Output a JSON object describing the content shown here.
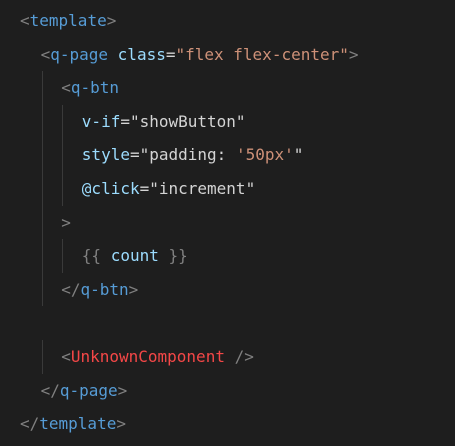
{
  "editor": {
    "language": "vue",
    "colors": {
      "background": "#1e1e1e",
      "punctuation": "#808080",
      "tag": "#569cd6",
      "attribute": "#9cdcfe",
      "string": "#ce9178",
      "text": "#d4d4d4",
      "unknown_component": "#f44747"
    },
    "lines": [
      {
        "indent": 0,
        "tokens": [
          {
            "t": "<",
            "c": "punct"
          },
          {
            "t": "template",
            "c": "tag"
          },
          {
            "t": ">",
            "c": "punct"
          }
        ]
      },
      {
        "indent": 1,
        "tokens": [
          {
            "t": "<",
            "c": "punct"
          },
          {
            "t": "q-page",
            "c": "tag"
          },
          {
            "t": " ",
            "c": "text"
          },
          {
            "t": "class",
            "c": "attr"
          },
          {
            "t": "=",
            "c": "text"
          },
          {
            "t": "\"flex flex-center\"",
            "c": "str"
          },
          {
            "t": ">",
            "c": "punct"
          }
        ]
      },
      {
        "indent": 2,
        "tokens": [
          {
            "t": "<",
            "c": "punct"
          },
          {
            "t": "q-btn",
            "c": "tag"
          }
        ]
      },
      {
        "indent": 3,
        "tokens": [
          {
            "t": "v-if",
            "c": "attr"
          },
          {
            "t": "=",
            "c": "text"
          },
          {
            "t": "\"showButton\"",
            "c": "text"
          }
        ]
      },
      {
        "indent": 3,
        "tokens": [
          {
            "t": "style",
            "c": "attr"
          },
          {
            "t": "=",
            "c": "text"
          },
          {
            "t": "\"padding: ",
            "c": "text"
          },
          {
            "t": "'50px'",
            "c": "str"
          },
          {
            "t": "\"",
            "c": "text"
          }
        ]
      },
      {
        "indent": 3,
        "tokens": [
          {
            "t": "@click",
            "c": "attr"
          },
          {
            "t": "=",
            "c": "text"
          },
          {
            "t": "\"increment\"",
            "c": "text"
          }
        ]
      },
      {
        "indent": 2,
        "tokens": [
          {
            "t": ">",
            "c": "punct"
          }
        ]
      },
      {
        "indent": 3,
        "tokens": [
          {
            "t": "{{ ",
            "c": "punct"
          },
          {
            "t": "count",
            "c": "attr"
          },
          {
            "t": " }}",
            "c": "punct"
          }
        ]
      },
      {
        "indent": 2,
        "tokens": [
          {
            "t": "</",
            "c": "punct"
          },
          {
            "t": "q-btn",
            "c": "tag"
          },
          {
            "t": ">",
            "c": "punct"
          }
        ]
      },
      {
        "indent": 0,
        "tokens": []
      },
      {
        "indent": 2,
        "tokens": [
          {
            "t": "<",
            "c": "punct"
          },
          {
            "t": "UnknownComponent",
            "c": "ctag"
          },
          {
            "t": " />",
            "c": "punct"
          }
        ]
      },
      {
        "indent": 1,
        "tokens": [
          {
            "t": "</",
            "c": "punct"
          },
          {
            "t": "q-page",
            "c": "tag"
          },
          {
            "t": ">",
            "c": "punct"
          }
        ]
      },
      {
        "indent": 0,
        "tokens": [
          {
            "t": "</",
            "c": "punct"
          },
          {
            "t": "template",
            "c": "tag"
          },
          {
            "t": ">",
            "c": "punct"
          }
        ]
      }
    ]
  }
}
